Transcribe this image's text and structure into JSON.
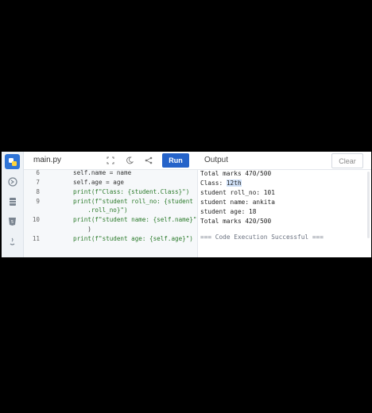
{
  "header": {
    "file_tab": "main.py",
    "run_label": "Run",
    "output_label": "Output",
    "clear_label": "Clear"
  },
  "icons": [
    "python-icon",
    "terminal-icon",
    "database-icon",
    "html5-icon",
    "java-icon",
    "expand-icon",
    "moon-icon",
    "share-icon"
  ],
  "editor": {
    "lines": [
      {
        "num": "6",
        "code": "self.name = name"
      },
      {
        "num": "7",
        "code": "self.age = age"
      },
      {
        "num": "8",
        "code": "print(f\"Class: {student.Class}\")"
      },
      {
        "num": "9",
        "code": "print(f\"student roll_no: {student"
      },
      {
        "num": "",
        "code": "    .roll_no}\")"
      },
      {
        "num": "10",
        "code": "print(f\"student name: {self.name}\""
      },
      {
        "num": "",
        "code": "    )"
      },
      {
        "num": "11",
        "code": "print(f\"student age: {self.age}\")"
      }
    ]
  },
  "output": {
    "lines": [
      "Total marks 470/500",
      "Class: ",
      "student roll_no: 101",
      "student name: ankita",
      "student age: 18",
      "Total marks 420/500",
      "",
      "=== Code Execution Successful ==="
    ],
    "highlight": "12th"
  },
  "colors": {
    "accent": "#2563c9",
    "sidebar_active": "#2f74d6"
  }
}
